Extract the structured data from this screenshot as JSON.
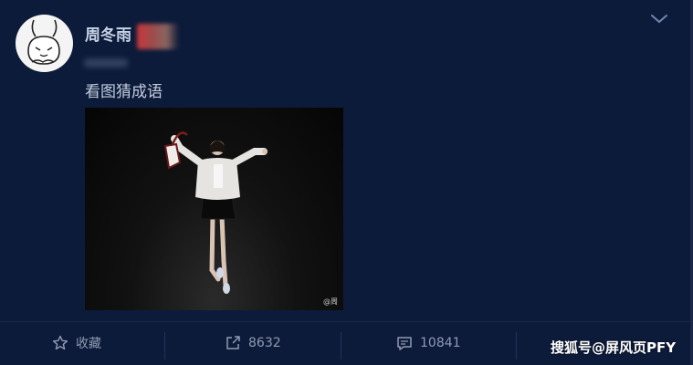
{
  "post": {
    "author": "周冬雨",
    "text": "看图猜成语",
    "image_watermark": "@周"
  },
  "actions": {
    "favorite_label": "收藏",
    "repost_count": "8632",
    "comment_count": "10841"
  },
  "overlay": {
    "site_watermark": "搜狐号@屏风页PFY"
  },
  "colors": {
    "background": "#0d1b3a",
    "text": "#c3cddf",
    "muted": "#8f9bb3"
  }
}
